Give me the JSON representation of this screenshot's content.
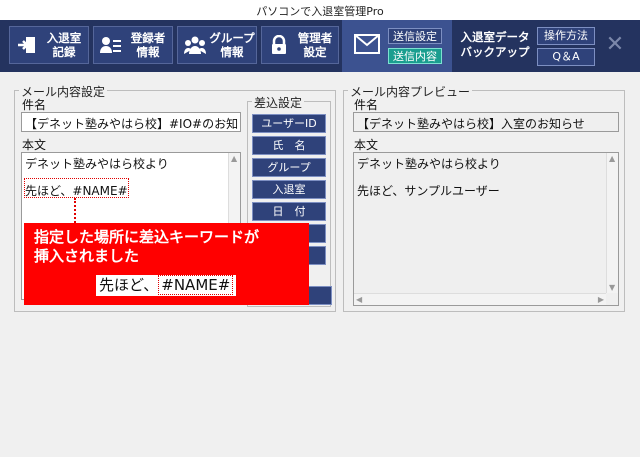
{
  "window": {
    "title": "パソコンで入退室管理Pro"
  },
  "toolbar": {
    "items": [
      {
        "label": "入退室\n記録",
        "icon": "door-enter-icon"
      },
      {
        "label": "登録者\n情報",
        "icon": "user-list-icon"
      },
      {
        "label": "グループ\n情報",
        "icon": "group-icon"
      },
      {
        "label": "管理者\n設定",
        "icon": "lock-icon"
      }
    ],
    "mail_icon": "envelope-icon",
    "send_setting": "送信設定",
    "send_content": "送信内容",
    "backup": "入退室データ\nバックアップ",
    "howto": "操作方法",
    "qa": "Q＆A",
    "close": "✕",
    "colors": {
      "bar": "#24335f",
      "button": "#2f427a",
      "active": "#1a9e8f",
      "alert": "#ff0000"
    }
  },
  "mail_settings": {
    "group_label": "メール内容設定",
    "subject_label": "件名",
    "subject_value": "【デネット塾みやはら校】#IO#のお知らせ",
    "body_label": "本文",
    "body_line1": "デネット塾みやはら校より",
    "body_line2": "先ほど、#NAME#"
  },
  "insert_settings": {
    "group_label": "差込設定",
    "buttons": [
      "ユーザーID",
      "氏　名",
      "グループ",
      "入退室",
      "日　付"
    ]
  },
  "preview": {
    "group_label": "メール内容プレビュー",
    "subject_label": "件名",
    "subject_value": "【デネット塾みやはら校】入室のお知らせ",
    "body_label": "本文",
    "body_line1": "デネット塾みやはら校より",
    "body_line2": "先ほど、サンプルユーザー"
  },
  "callout": {
    "line1": "指定した場所に差込キーワードが",
    "line2": "挿入されました",
    "example_prefix": "先ほど、",
    "example_keyword": "#NAME#"
  }
}
